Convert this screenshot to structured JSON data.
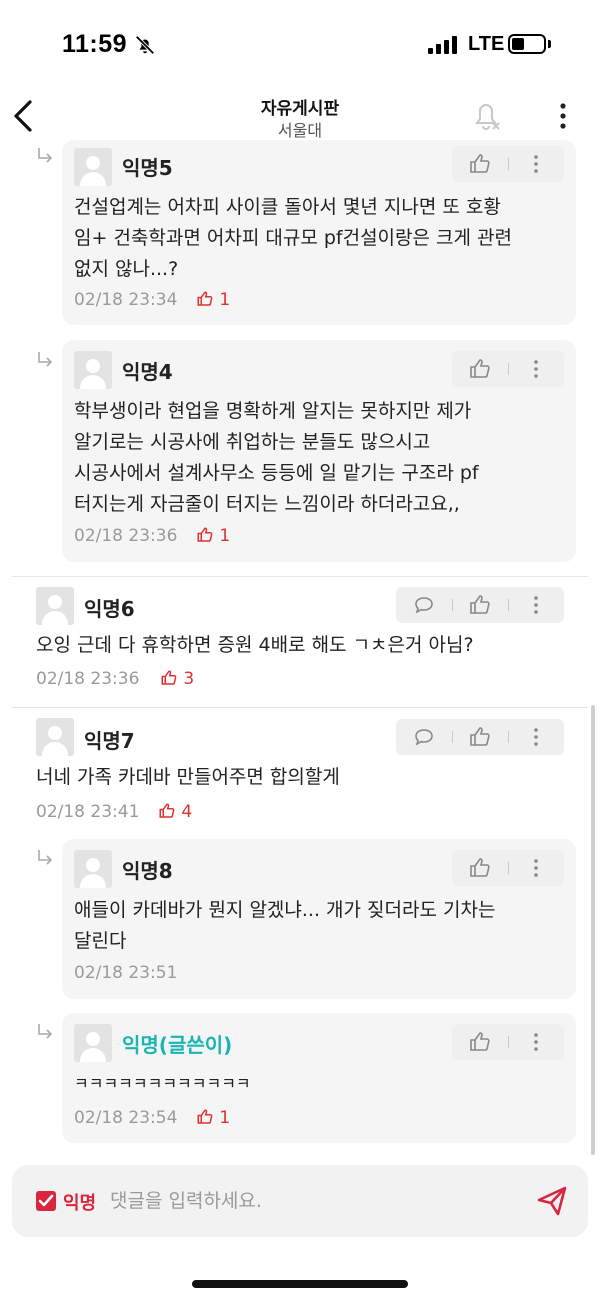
{
  "status_bar": {
    "time": "11:59",
    "network": "LTE"
  },
  "header": {
    "title": "자유게시판",
    "subtitle": "서울대"
  },
  "comments": [
    {
      "author": "익명5",
      "body_lines": [
        "건설업계는 어차피 사이클 돌아서 몇년 지나면 또 호황",
        "임+ 건축학과면 어차피 대규모 pf건설이랑은 크게 관련",
        "없지 않나...?"
      ],
      "date": "02/18 23:34",
      "likes": "1",
      "is_reply": true
    },
    {
      "author": "익명4",
      "body_lines": [
        "학부생이라 현업을 명확하게 알지는 못하지만 제가",
        "알기로는 시공사에 취업하는 분들도 많으시고",
        "시공사에서 설계사무소 등등에 일 맡기는 구조라 pf",
        "터지는게 자금줄이 터지는 느낌이라 하더라고요,,"
      ],
      "date": "02/18 23:36",
      "likes": "1",
      "is_reply": true
    },
    {
      "author": "익명6",
      "body_lines": [
        "오잉 근데 다 휴학하면 증원 4배로 해도 ㄱㅊ은거 아님?"
      ],
      "date": "02/18 23:36",
      "likes": "3",
      "is_reply": false
    },
    {
      "author": "익명7",
      "body_lines": [
        "너네 가족 카데바 만들어주면 합의할게"
      ],
      "date": "02/18 23:41",
      "likes": "4",
      "is_reply": false
    },
    {
      "author": "익명8",
      "body_lines": [
        "애들이 카데바가 뭔지 알겠냐... 개가 짖더라도 기차는",
        "달린다"
      ],
      "date": "02/18 23:51",
      "likes": "",
      "is_reply": true
    },
    {
      "author": "익명(글쓴이)",
      "body_lines": [
        "ㅋㅋㅋㅋㅋㅋㅋㅋㅋㅋㅋㅋ"
      ],
      "date": "02/18 23:54",
      "likes": "1",
      "is_reply": true
    }
  ],
  "input": {
    "anon_label": "익명",
    "anon_checked": true,
    "placeholder": "댓글을 입력하세요."
  },
  "colors": {
    "accent_red": "#d7263d",
    "op_teal": "#1bb5b5",
    "reply_bg": "#f5f5f5"
  },
  "icons": [
    "bell-slash-icon",
    "signal-icon",
    "battery-icon",
    "back-chevron-icon",
    "notification-bell-icon",
    "more-vertical-icon",
    "reply-arrow-icon",
    "thumbs-up-icon",
    "comment-bubble-icon",
    "send-icon",
    "checkbox-icon"
  ]
}
